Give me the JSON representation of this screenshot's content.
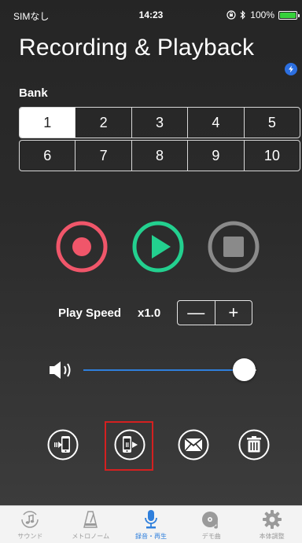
{
  "status_bar": {
    "carrier": "SIMなし",
    "time": "14:23",
    "battery": "100%"
  },
  "header": {
    "title": "Recording & Playback"
  },
  "bank": {
    "label": "Bank",
    "selected": "1",
    "row1": [
      "1",
      "2",
      "3",
      "4",
      "5"
    ],
    "row2": [
      "6",
      "7",
      "8",
      "9",
      "10"
    ]
  },
  "transport": {
    "icons": [
      "record-icon",
      "play-icon",
      "stop-icon"
    ],
    "colors": {
      "record": "#f0566a",
      "play": "#23d08f",
      "stop": "#8a8a8a"
    }
  },
  "speed": {
    "label": "Play Speed",
    "value": "x1.0",
    "minus": "—",
    "plus": "+"
  },
  "volume": {
    "level": 0.93
  },
  "actions": {
    "icons": [
      "phone-import-icon",
      "phone-export-icon",
      "mail-icon",
      "trash-icon"
    ]
  },
  "tabbar": {
    "items": [
      {
        "label": "サウンド",
        "icon": "music-note-icon"
      },
      {
        "label": "メトロノーム",
        "icon": "metronome-icon"
      },
      {
        "label": "録音・再生",
        "icon": "microphone-icon"
      },
      {
        "label": "デモ曲",
        "icon": "disc-icon"
      },
      {
        "label": "本体調整",
        "icon": "gear-icon"
      }
    ],
    "active_index": 2,
    "active_color": "#2f7fdc"
  }
}
